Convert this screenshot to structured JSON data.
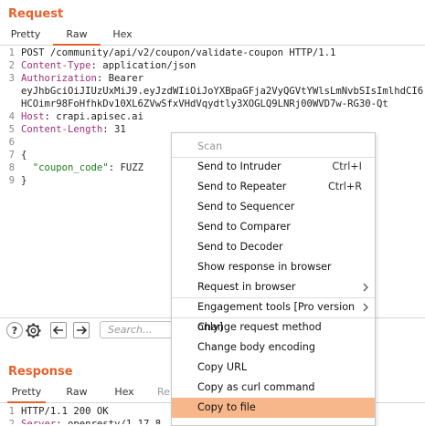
{
  "request": {
    "title": "Request",
    "tabs": [
      "Pretty",
      "Raw",
      "Hex"
    ],
    "lines": [
      {
        "n": "1",
        "parts": [
          {
            "t": "POST /community/api/v2/coupon/validate-coupon HTTP/1.1",
            "c": ""
          }
        ]
      },
      {
        "n": "2",
        "parts": [
          {
            "t": "Content-Type",
            "c": "hdr"
          },
          {
            "t": ": application/json",
            "c": ""
          }
        ]
      },
      {
        "n": "3",
        "parts": [
          {
            "t": "Authorization",
            "c": "hdr"
          },
          {
            "t": ": Bearer",
            "c": ""
          }
        ]
      },
      {
        "n": "",
        "parts": [
          {
            "t": "eyJhbGciOiJIUzUxMiJ9.eyJzdWIiOiJoYXBpaGFja2VyQGVtYWlsLmNvbSIsImlhdCI6",
            "c": ""
          }
        ]
      },
      {
        "n": "",
        "parts": [
          {
            "t": "HCOimr98FoHfhkDv10XL6ZVwSfxVHdVqydtly3XOGLQ9LNRj00WVD7w-RG30-Qt",
            "c": ""
          }
        ]
      },
      {
        "n": "4",
        "parts": [
          {
            "t": "Host",
            "c": "hdr"
          },
          {
            "t": ": crapi.apisec.ai",
            "c": ""
          }
        ]
      },
      {
        "n": "5",
        "parts": [
          {
            "t": "Content-Length",
            "c": "hdr"
          },
          {
            "t": ": 31",
            "c": ""
          }
        ]
      },
      {
        "n": "6",
        "parts": [
          {
            "t": "",
            "c": ""
          }
        ]
      },
      {
        "n": "7",
        "parts": [
          {
            "t": "{",
            "c": ""
          }
        ]
      },
      {
        "n": "8",
        "parts": [
          {
            "t": "  ",
            "c": ""
          },
          {
            "t": "\"coupon_code\"",
            "c": "strkey"
          },
          {
            "t": ": FUZZ",
            "c": ""
          }
        ]
      },
      {
        "n": "9",
        "parts": [
          {
            "t": "}",
            "c": ""
          }
        ]
      }
    ]
  },
  "toolbar": {
    "search_placeholder": "Search..."
  },
  "response": {
    "title": "Response",
    "tabs": [
      "Pretty",
      "Raw",
      "Hex",
      "Re"
    ],
    "lines": [
      {
        "n": "1",
        "parts": [
          {
            "t": "HTTP/1.1 200 OK",
            "c": ""
          }
        ]
      },
      {
        "n": "2",
        "parts": [
          {
            "t": "Server",
            "c": "hdr"
          },
          {
            "t": ": openresty/1.17.8",
            "c": ""
          }
        ]
      }
    ]
  },
  "context_menu": {
    "items": [
      {
        "label": "Scan",
        "shortcut": "",
        "submenu": false,
        "disabled": true,
        "highlighted": false
      },
      {
        "label": "Send to Intruder",
        "shortcut": "Ctrl+I",
        "submenu": false,
        "disabled": false,
        "highlighted": false
      },
      {
        "label": "Send to Repeater",
        "shortcut": "Ctrl+R",
        "submenu": false,
        "disabled": false,
        "highlighted": false
      },
      {
        "label": "Send to Sequencer",
        "shortcut": "",
        "submenu": false,
        "disabled": false,
        "highlighted": false
      },
      {
        "label": "Send to Comparer",
        "shortcut": "",
        "submenu": false,
        "disabled": false,
        "highlighted": false
      },
      {
        "label": "Send to Decoder",
        "shortcut": "",
        "submenu": false,
        "disabled": false,
        "highlighted": false
      },
      {
        "label": "Show response in browser",
        "shortcut": "",
        "submenu": false,
        "disabled": false,
        "highlighted": false
      },
      {
        "label": "Request in browser",
        "shortcut": "",
        "submenu": true,
        "disabled": false,
        "highlighted": false
      },
      {
        "label": "Engagement tools [Pro version only]",
        "shortcut": "",
        "submenu": true,
        "disabled": false,
        "highlighted": false
      },
      {
        "label": "Change request method",
        "shortcut": "",
        "submenu": false,
        "disabled": false,
        "highlighted": false
      },
      {
        "label": "Change body encoding",
        "shortcut": "",
        "submenu": false,
        "disabled": false,
        "highlighted": false
      },
      {
        "label": "Copy URL",
        "shortcut": "",
        "submenu": false,
        "disabled": false,
        "highlighted": false
      },
      {
        "label": "Copy as curl command",
        "shortcut": "",
        "submenu": false,
        "disabled": false,
        "highlighted": false
      },
      {
        "label": "Copy to file",
        "shortcut": "",
        "submenu": false,
        "disabled": false,
        "highlighted": true
      }
    ]
  },
  "colors": {
    "accent": "#e8612c",
    "highlight": "#f7b78a",
    "header_name": "#a0307a",
    "json_key": "#1d7a1d"
  }
}
